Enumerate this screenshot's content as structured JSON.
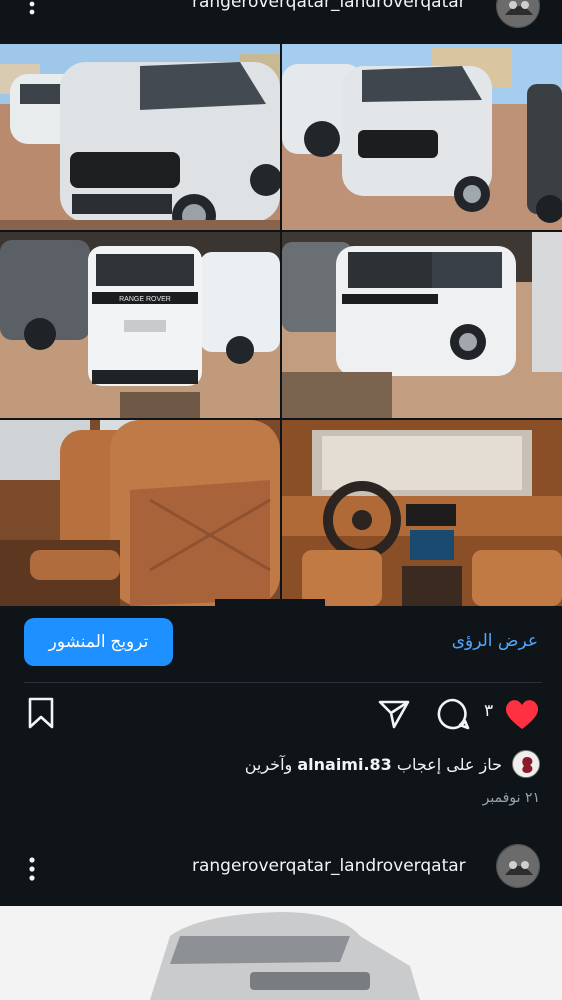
{
  "previous_post_header": {
    "username": "rangeroverqatar_landroverqatar",
    "more_icon": "more-vertical-icon"
  },
  "post": {
    "collage": {
      "images": [
        "white Range Rover front view in lot",
        "white Range Rover front three-quarter view",
        "white Range Rover rear view",
        "white Range Rover rear three-quarter view",
        "tan leather rear seats",
        "tan leather dashboard and steering wheel"
      ],
      "rear_badge_text": "RANGE ROVER"
    },
    "promote_button_label": "ترويج المنشور",
    "insights_link_label": "عرض الرؤى",
    "actions": {
      "like_count": "٣",
      "icons": [
        "heart-icon",
        "comment-icon",
        "share-icon",
        "bookmark-icon"
      ],
      "heart_color": "#ff3040"
    },
    "likes": {
      "prefix": "حاز على إعجاب",
      "liker": "alnaimi.83",
      "suffix": "وآخرين"
    },
    "date": "٢١ نوفمبر"
  },
  "next_post_header": {
    "username": "rangeroverqatar_landroverqatar",
    "more_icon": "more-vertical-icon"
  },
  "colors": {
    "background": "#0f1419",
    "accent": "#1e90ff",
    "link": "#4ea8ff"
  }
}
